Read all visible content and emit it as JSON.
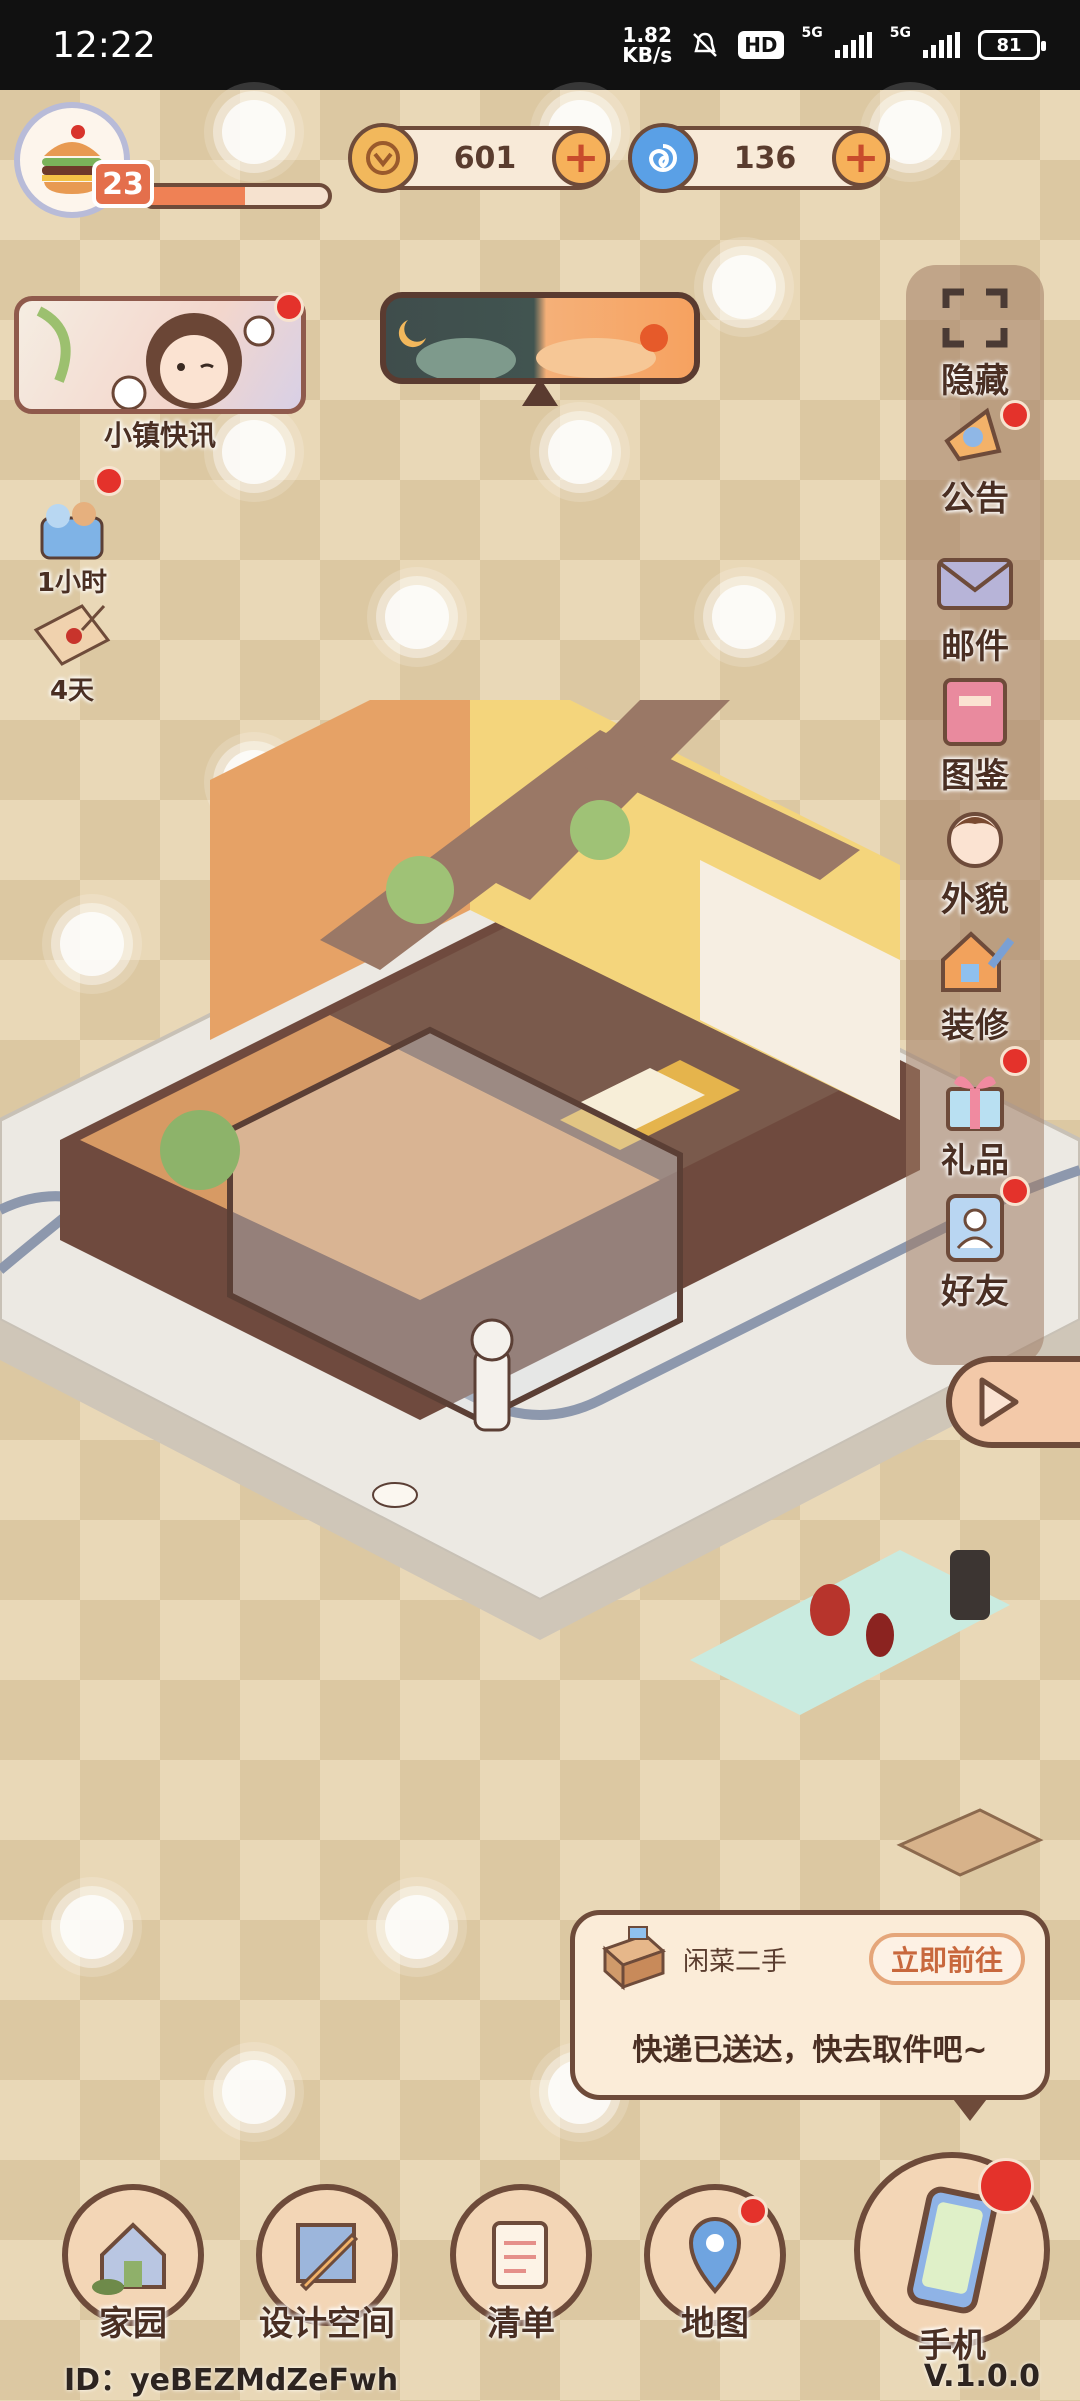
{
  "status_bar": {
    "time": "12:22",
    "net_speed_value": "1.82",
    "net_speed_unit": "KB/s",
    "hd_badge": "HD",
    "net_type_1": "5G",
    "net_type_2": "5G",
    "battery": "81"
  },
  "player": {
    "level": "23",
    "xp_progress": 0.55
  },
  "currencies": [
    {
      "name": "coin",
      "value": "601"
    },
    {
      "name": "gem",
      "value": "136"
    }
  ],
  "news": {
    "label": "小镇快讯"
  },
  "left_items": [
    {
      "label": "1小时"
    },
    {
      "label": "4天"
    }
  ],
  "sidebar": {
    "items": [
      {
        "label": "隐藏"
      },
      {
        "label": "公告"
      },
      {
        "label": "邮件"
      },
      {
        "label": "图鉴"
      },
      {
        "label": "外貌"
      },
      {
        "label": "装修"
      },
      {
        "label": "礼品"
      },
      {
        "label": "好友"
      }
    ]
  },
  "notification": {
    "sender": "闲菜二手",
    "action": "立即前往",
    "message": "快递已送达，快去取件吧~"
  },
  "bottom_nav": [
    {
      "label": "家园"
    },
    {
      "label": "设计空间"
    },
    {
      "label": "清单"
    },
    {
      "label": "地图"
    },
    {
      "label": "手机"
    }
  ],
  "footer": {
    "id_text": "ID：yeBEZMdZeFwh",
    "version": "V.1.0.0"
  },
  "colors": {
    "accent": "#e46f4c",
    "outline": "#6e4b3a",
    "badge_red": "#e4322b",
    "background": "#e9d8b7"
  }
}
